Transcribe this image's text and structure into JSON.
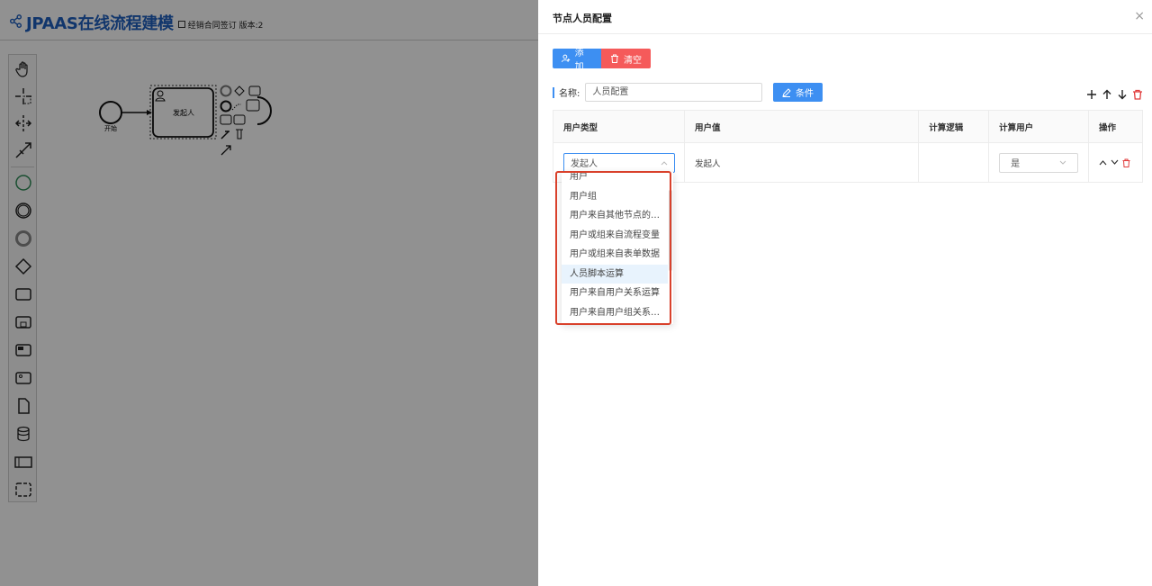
{
  "modeler": {
    "brand_title": "JPAAS在线流程建模",
    "sub_title": "经销合同签订 版本:2",
    "start_label": "开始",
    "task_label": "发起人"
  },
  "drawer": {
    "title": "节点人员配置",
    "close_icon": "×",
    "add_label": "添加",
    "clear_label": "清空",
    "name_label": "名称:",
    "name_value": "人员配置",
    "condition_label": "条件",
    "columns": [
      "用户类型",
      "用户值",
      "计算逻辑",
      "计算用户",
      "操作"
    ],
    "row": {
      "user_type": "发起人",
      "user_value": "发起人",
      "calc_logic": "",
      "calc_user": "是"
    },
    "dropdown_options": [
      "用户",
      "用户组",
      "用户来自其他节点的审批人",
      "用户或组来自流程变量",
      "用户或组来自表单数据",
      "人员脚本运算",
      "用户来自用户关系运算",
      "用户来自用户组关系运算"
    ],
    "highlighted_option": "人员脚本运算",
    "colors": {
      "primary": "#3d8ff2",
      "danger": "#f55a5a",
      "brand": "#1f5fbf",
      "highlight_border": "#d9412b"
    }
  }
}
